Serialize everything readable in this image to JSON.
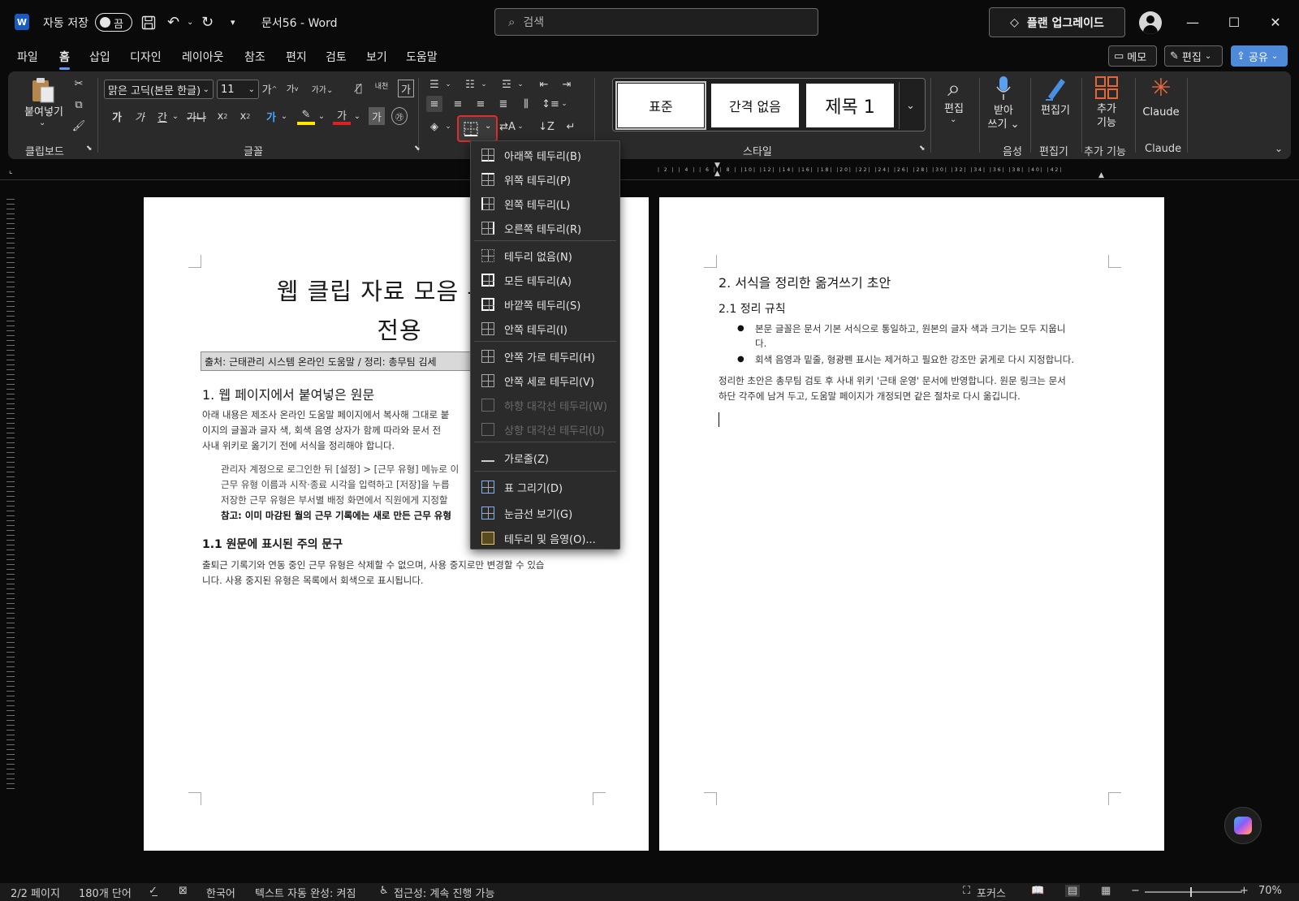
{
  "app": {
    "autosave_label": "자동 저장",
    "autosave_state": "끔",
    "doc_title": "문서56  -  Word",
    "search_placeholder": "검색",
    "upgrade_label": "플랜 업그레이드"
  },
  "tabs": [
    "파일",
    "홈",
    "삽입",
    "디자인",
    "레이아웃",
    "참조",
    "편지",
    "검토",
    "보기",
    "도움말"
  ],
  "active_tab": "홈",
  "right_buttons": {
    "memo": "메모",
    "edit": "편집",
    "share": "공유"
  },
  "ribbon": {
    "clipboard": {
      "paste_label": "붙여넣기",
      "group_label": "클립보드"
    },
    "font": {
      "font_name": "맑은 고딕(본문 한글)",
      "font_size": "11",
      "group_label": "글꼴",
      "phonetic": "내천"
    },
    "styles": {
      "cards": [
        "표준",
        "간격 없음",
        "제목 1"
      ],
      "group_label": "스타일"
    },
    "editing": {
      "label": "편집"
    },
    "voice": {
      "label_line1": "받아",
      "label_line2": "쓰기",
      "group_label": "음성"
    },
    "editor": {
      "label": "편집기",
      "group_label": "편집기"
    },
    "addins": {
      "label_line1": "추가",
      "label_line2": "기능",
      "group_label": "추가 기능"
    },
    "claude": {
      "label": "Claude",
      "group_label": "Claude"
    }
  },
  "border_menu": {
    "items": [
      {
        "label": "아래쪽 테두리(B)",
        "icon": "bottom-border-icon",
        "disabled": false
      },
      {
        "label": "위쪽 테두리(P)",
        "icon": "top-border-icon",
        "disabled": false
      },
      {
        "label": "왼쪽 테두리(L)",
        "icon": "left-border-icon",
        "disabled": false
      },
      {
        "label": "오른쪽 테두리(R)",
        "icon": "right-border-icon",
        "disabled": false
      },
      {
        "label": "테두리 없음(N)",
        "icon": "no-border-icon",
        "disabled": false
      },
      {
        "label": "모든 테두리(A)",
        "icon": "all-borders-icon",
        "disabled": false
      },
      {
        "label": "바깥쪽 테두리(S)",
        "icon": "outside-borders-icon",
        "disabled": false
      },
      {
        "label": "안쪽 테두리(I)",
        "icon": "inside-borders-icon",
        "disabled": false
      },
      {
        "label": "안쪽 가로 테두리(H)",
        "icon": "inside-horizontal-border-icon",
        "disabled": false
      },
      {
        "label": "안쪽 세로 테두리(V)",
        "icon": "inside-vertical-border-icon",
        "disabled": false
      },
      {
        "label": "하향 대각선 테두리(W)",
        "icon": "diagonal-down-border-icon",
        "disabled": true
      },
      {
        "label": "상향 대각선 테두리(U)",
        "icon": "diagonal-up-border-icon",
        "disabled": true
      },
      {
        "label": "가로줄(Z)",
        "icon": "horizontal-line-icon",
        "disabled": false
      },
      {
        "label": "표 그리기(D)",
        "icon": "draw-table-icon",
        "disabled": false
      },
      {
        "label": "눈금선 보기(G)",
        "icon": "view-gridlines-icon",
        "disabled": false
      },
      {
        "label": "테두리 및 음영(O)...",
        "icon": "borders-shading-icon",
        "disabled": false
      }
    ]
  },
  "page1": {
    "title_line1": "웹 클립 자료 모음 — 사",
    "title_line2": "전용",
    "source": "출처: 근태관리 시스템 온라인 도움말 / 정리: 총무팀 김세",
    "h1": "1. 웹 페이지에서 붙여넣은 원문",
    "para1": [
      "아래 내용은 제조사 온라인 도움말 페이지에서 복사해 그대로 붙",
      "이지의 글꼴과 글자 색, 회색 음영 상자가 함께 따라와 문서 전",
      "사내 위키로 옮기기 전에 서식을 정리해야 합니다."
    ],
    "indent": [
      "관리자 계정으로 로그인한 뒤 [설정] > [근무 유형] 메뉴로 이",
      "근무 유형 이름과 시작·종료 시각을 입력하고 [저장]을 누릅",
      "저장한 근무 유형은 부서별 배정 화면에서 직원에게 지정할"
    ],
    "note": "참고: 이미 마감된 월의 근무 기록에는 새로 만든 근무 유형",
    "h2": "1.1 원문에 표시된 주의 문구",
    "para2": [
      "출퇴근 기록기와 연동 중인 근무 유형은 삭제할 수 없으며, 사용 중지로만 변경할 수 있습",
      "니다. 사용 중지된 유형은 목록에서 회색으로 표시됩니다."
    ]
  },
  "page2": {
    "h1": "2. 서식을 정리한 옮겨쓰기 초안",
    "h2": "2.1 정리 규칙",
    "bullets": [
      [
        "본문 글꼴은 문서 기본 서식으로 통일하고, 원본의 글자 색과 크기는 모두 지웁니",
        "다."
      ],
      [
        "회색 음영과 밑줄, 형광펜 표시는 제거하고 필요한 강조만 굵게로 다시 지정합니다."
      ]
    ],
    "para": [
      "정리한 초안은 총무팀 검토 후 사내 위키 '근태 운영' 문서에 반영합니다. 원문 링크는 문서",
      "하단 각주에 남겨 두고, 도움말 페이지가 개정되면 같은 절차로 다시 옮깁니다."
    ]
  },
  "ruler_numbers": "| 2 |  | 4 |  | 6 |  | 8 |  |10|  |12|  |14|  |16|  |18|  |20|  |22|  |24|  |26|  |28|  |30|  |32|  |34|  |36|  |38|  |40|  |42|",
  "status": {
    "page": "2/2 페이지",
    "words": "180개 단어",
    "language": "한국어",
    "autocomplete": "텍스트 자동 완성: 켜짐",
    "accessibility": "접근성: 계속 진행 가능",
    "focus": "포커스",
    "zoom": "70%"
  },
  "colors": {
    "accent": "#5a9bf7",
    "highlight_border": "#e22b2b",
    "share": "#4e8ad7"
  }
}
